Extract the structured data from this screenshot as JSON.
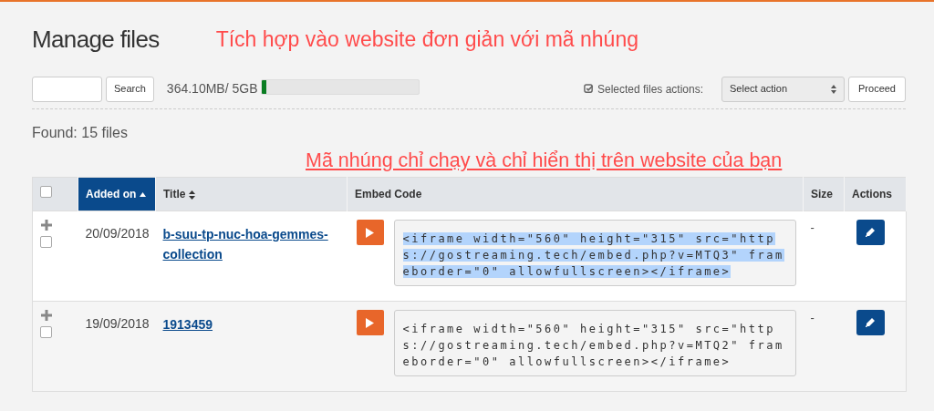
{
  "page": {
    "title": "Manage files"
  },
  "annotations": [
    {
      "text": "Tích hợp vào website đơn giản với mã nhúng",
      "underlined": false
    },
    {
      "text": "Mã nhúng chỉ chạy và chỉ hiển thị trên website của bạn",
      "underlined": true
    }
  ],
  "toolbar": {
    "search_button": "Search",
    "storage_text": "364.10MB/ 5GB",
    "storage": {
      "level": 0.025
    },
    "bulk_label": "Selected files actions:",
    "bulk_select": "Select action",
    "proceed_button": "Proceed"
  },
  "found_text": "Found: 15 files",
  "table": {
    "select_all": {
      "checked": false
    },
    "columns": [
      {
        "label": "Added on",
        "sortable": true,
        "sorted": true
      },
      {
        "label": "Title",
        "sortable": true,
        "sorted": false
      },
      {
        "label": "Embed Code",
        "sortable": false,
        "sorted": false
      },
      {
        "label": "Size",
        "sortable": false,
        "sorted": false
      },
      {
        "label": "Actions",
        "sortable": false,
        "sorted": false
      }
    ],
    "rows": [
      {
        "checked": false,
        "date": "20/09/2018",
        "title": "b-suu-tp-nuc-hoa-gemmes-collection",
        "embed": "<iframe width=\"560\" height=\"315\" src=\"https://gostreaming.tech/embed.php?v=MTQ3\" frameborder=\"0\"  allowfullscreen></iframe>",
        "embed_selected": true,
        "size": "-"
      },
      {
        "checked": false,
        "date": "19/09/2018",
        "title": "1913459",
        "embed": "<iframe width=\"560\" height=\"315\" src=\"https://gostreaming.tech/embed.php?v=MTQ2\" frameborder=\"0\"  allowfullscreen></iframe>",
        "embed_selected": false,
        "size": "-"
      }
    ]
  }
}
